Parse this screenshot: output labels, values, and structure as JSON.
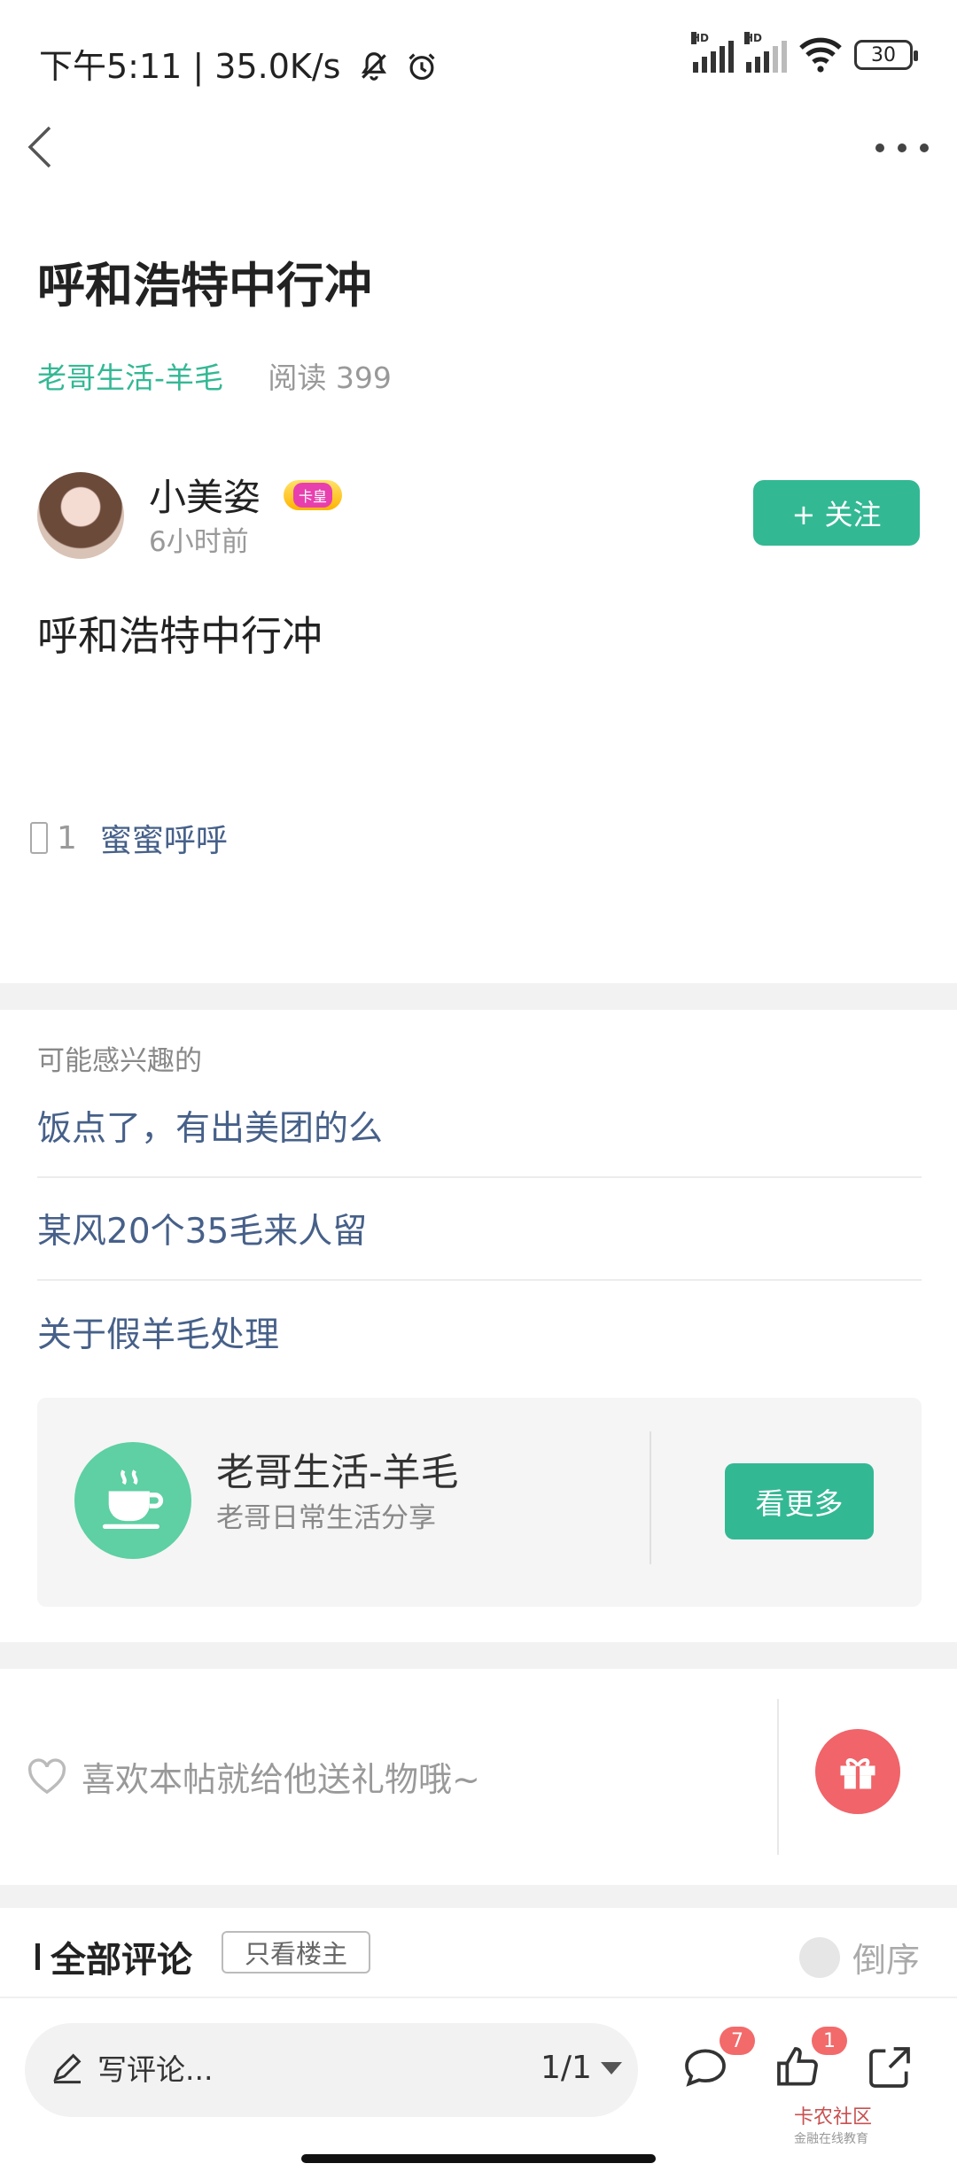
{
  "status_bar": {
    "time": "下午5:11 | 35.0K/s",
    "signal_labels": [
      "HD",
      "HD"
    ],
    "battery": "30"
  },
  "post": {
    "title": "呼和浩特中行冲",
    "circle": "老哥生活-羊毛",
    "read_count": "阅读 399",
    "author": "小美姿",
    "vip_badge": "卡皇",
    "time_ago": "6小时前",
    "follow_label": "+  关注",
    "content": "呼和浩特中行冲",
    "like_count": "1",
    "liker": "蜜蜜呼呼"
  },
  "interest": {
    "label": "可能感兴趣的",
    "items": [
      "饭点了，有出美团的么",
      "某风20个35毛来人留",
      "关于假羊毛处理"
    ]
  },
  "circle_card": {
    "name": "老哥生活-羊毛",
    "desc": "老哥日常生活分享",
    "more_label": "看更多"
  },
  "gift": {
    "text": "喜欢本帖就给他送礼物哦~"
  },
  "comments": {
    "title": "全部评论",
    "only_op": "只看楼主",
    "sort": "倒序"
  },
  "bottom_bar": {
    "write_placeholder": "写评论...",
    "pager": "1/1",
    "comment_badge": "7",
    "like_badge": "1"
  },
  "watermark": {
    "brand": "卡农社区",
    "slogan": "金融在线教育"
  },
  "colors": {
    "accent": "#33b894",
    "link": "#466089",
    "gift": "#f0646a",
    "badge": "#f36a6a"
  }
}
